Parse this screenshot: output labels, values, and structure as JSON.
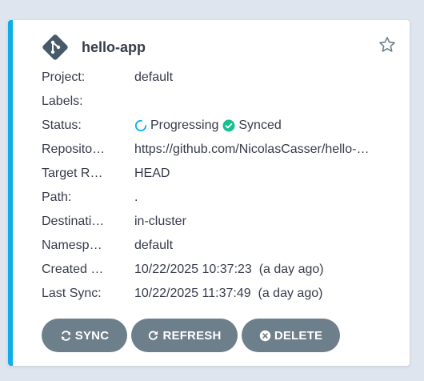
{
  "app": {
    "name": "hello-app",
    "accent_color": "#0dadea"
  },
  "fields": [
    {
      "label": "Project:",
      "value": "default"
    },
    {
      "label": "Labels:",
      "value": ""
    },
    {
      "label": "Status:",
      "value": ""
    },
    {
      "label": "Reposito…",
      "value": "https://github.com/NicolasCasser/hello-…"
    },
    {
      "label": "Target R…",
      "value": "HEAD"
    },
    {
      "label": "Path:",
      "value": "."
    },
    {
      "label": "Destinati…",
      "value": "in-cluster"
    },
    {
      "label": "Namesp…",
      "value": "default"
    },
    {
      "label": "Created …",
      "value": "10/22/2025 10:37:23  (a day ago)"
    },
    {
      "label": "Last Sync:",
      "value": "10/22/2025 11:37:49  (a day ago)"
    }
  ],
  "status": {
    "health": "Progressing",
    "health_icon": "progressing-circle-icon",
    "health_color": "#0dadea",
    "sync": "Synced",
    "sync_icon": "check-circle-icon",
    "sync_color": "#18be94"
  },
  "buttons": {
    "sync": "SYNC",
    "refresh": "REFRESH",
    "delete": "DELETE"
  }
}
